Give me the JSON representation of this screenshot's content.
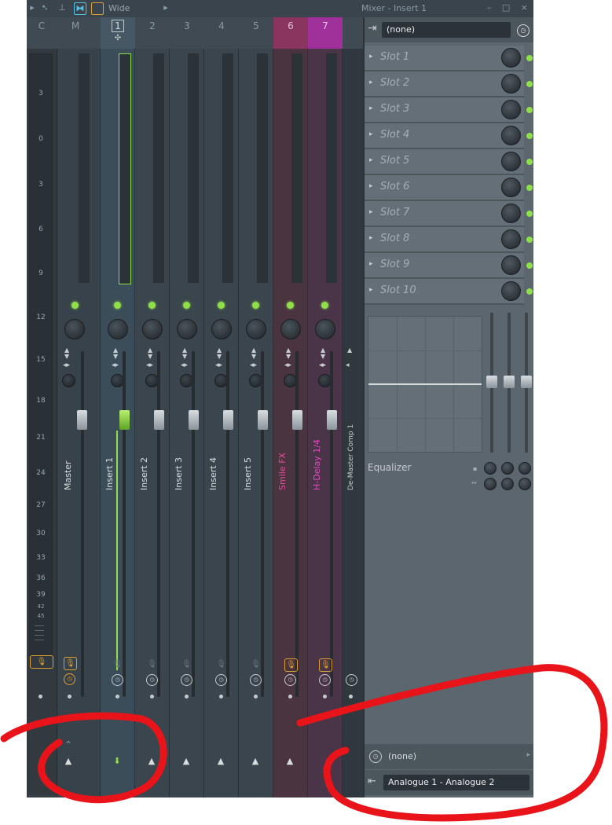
{
  "toolbar": {
    "preset_label": "Wide",
    "window_title": "Mixer - Insert 1",
    "window_controls": "– □ ×"
  },
  "headers": {
    "cols": [
      "C",
      "M",
      "1",
      "2",
      "3",
      "4",
      "5",
      "6",
      "7"
    ]
  },
  "meter_scale": [
    "3",
    "0",
    "3",
    "6",
    "9",
    "12",
    "15",
    "18",
    "21",
    "24",
    "27",
    "30",
    "33",
    "36",
    "39",
    "42",
    "45"
  ],
  "tracks": [
    {
      "name": "Master"
    },
    {
      "name": "Insert 1"
    },
    {
      "name": "Insert 2"
    },
    {
      "name": "Insert 3"
    },
    {
      "name": "Insert 4"
    },
    {
      "name": "Insert 5"
    },
    {
      "name": "Smile FX"
    },
    {
      "name": "H-Delay 1/4"
    }
  ],
  "partial_track_name": "De-Master Comp 1",
  "panel": {
    "input_select": "(none)",
    "slots": [
      "Slot 1",
      "Slot 2",
      "Slot 3",
      "Slot 4",
      "Slot 5",
      "Slot 6",
      "Slot 7",
      "Slot 8",
      "Slot 9",
      "Slot 10"
    ],
    "eq_label": "Equalizer",
    "output_none": "(none)",
    "output_select": "Analogue 1 - Analogue 2"
  },
  "colors": {
    "accent_green": "#8fe048",
    "arm_orange": "#e0a030",
    "smile_pink": "#e64a9a",
    "hdelay_magenta": "#e64ac0",
    "annotation_red": "#e8141a"
  }
}
